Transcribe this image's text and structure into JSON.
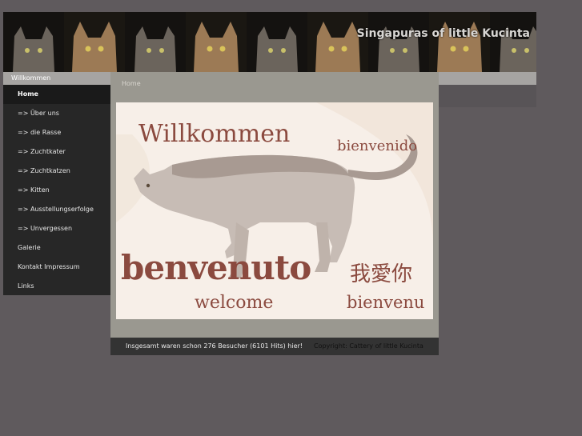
{
  "header": {
    "site_title": "Singapuras of little Kucinta"
  },
  "sidebar": {
    "section_title": "Willkommen",
    "items": [
      {
        "label": "Home",
        "active": true
      },
      {
        "label": "=> Über uns"
      },
      {
        "label": "=> die Rasse"
      },
      {
        "label": "=> Zuchtkater"
      },
      {
        "label": "=> Zuchtkatzen"
      },
      {
        "label": "=> Kitten"
      },
      {
        "label": "=> Ausstellungserfolge"
      },
      {
        "label": "=> Unvergessen"
      },
      {
        "label": "Galerie"
      },
      {
        "label": "Kontakt Impressum"
      },
      {
        "label": "Links"
      }
    ]
  },
  "main": {
    "breadcrumb": "Home",
    "welcome_image": {
      "words": {
        "willkommen": "Willkommen",
        "bienvenido": "bienvenido",
        "benvenuto": "benvenuto",
        "chinese": "我愛你",
        "welcome": "welcome",
        "bienvenu": "bienvenu"
      }
    }
  },
  "footer": {
    "visitor_count": "Insgesamt waren schon 276 Besucher (6101 Hits) hier!",
    "copyright": "Copyright: Cattery of little Kucinta"
  },
  "colors": {
    "page_bg": "#5f5a5d",
    "sidebar_bg": "#272727",
    "main_bg": "#9a9890",
    "strip_bg": "#a6a4a2",
    "footer_bg": "#333333",
    "welcome_text": "#8b4a3f"
  }
}
